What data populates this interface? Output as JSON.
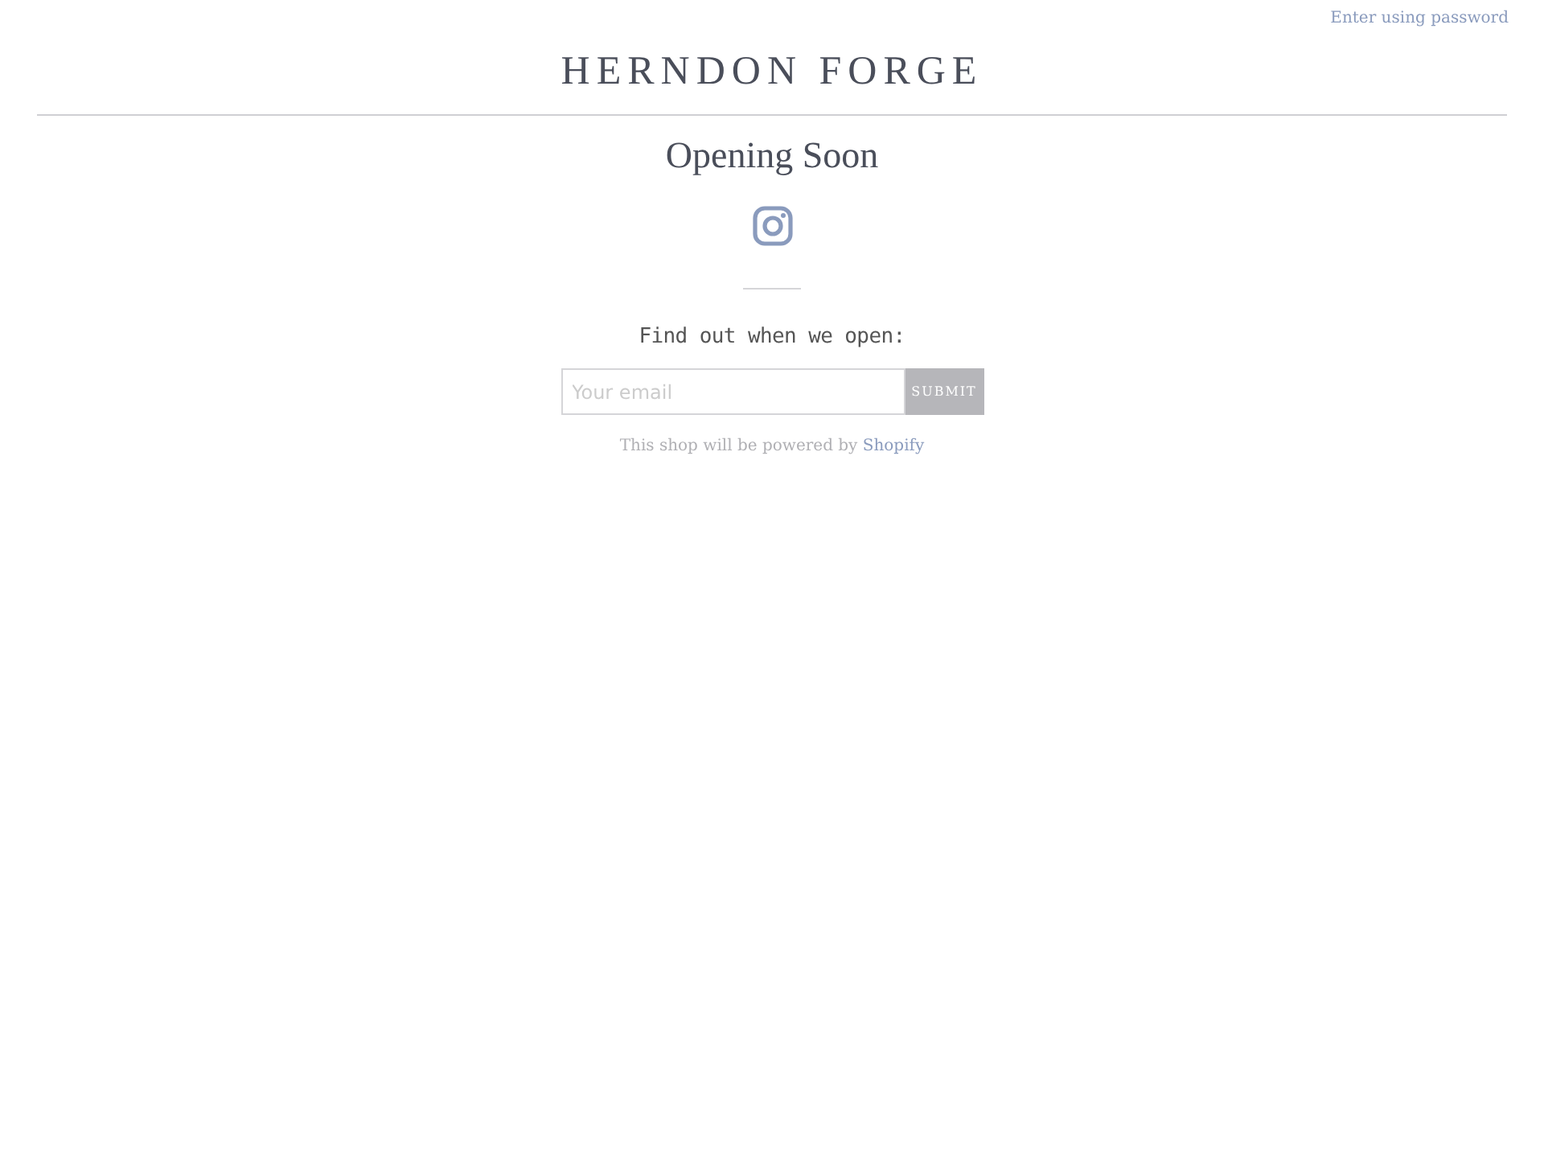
{
  "header": {
    "password_link": "Enter using password",
    "logo": "HERNDON FORGE"
  },
  "main": {
    "heading": "Opening Soon",
    "signup_label": "Find out when we open:",
    "email": {
      "placeholder": "Your email"
    },
    "submit": "SUBMIT",
    "powered_by": "This shop will be powered by",
    "powered_link": "Shopify"
  }
}
